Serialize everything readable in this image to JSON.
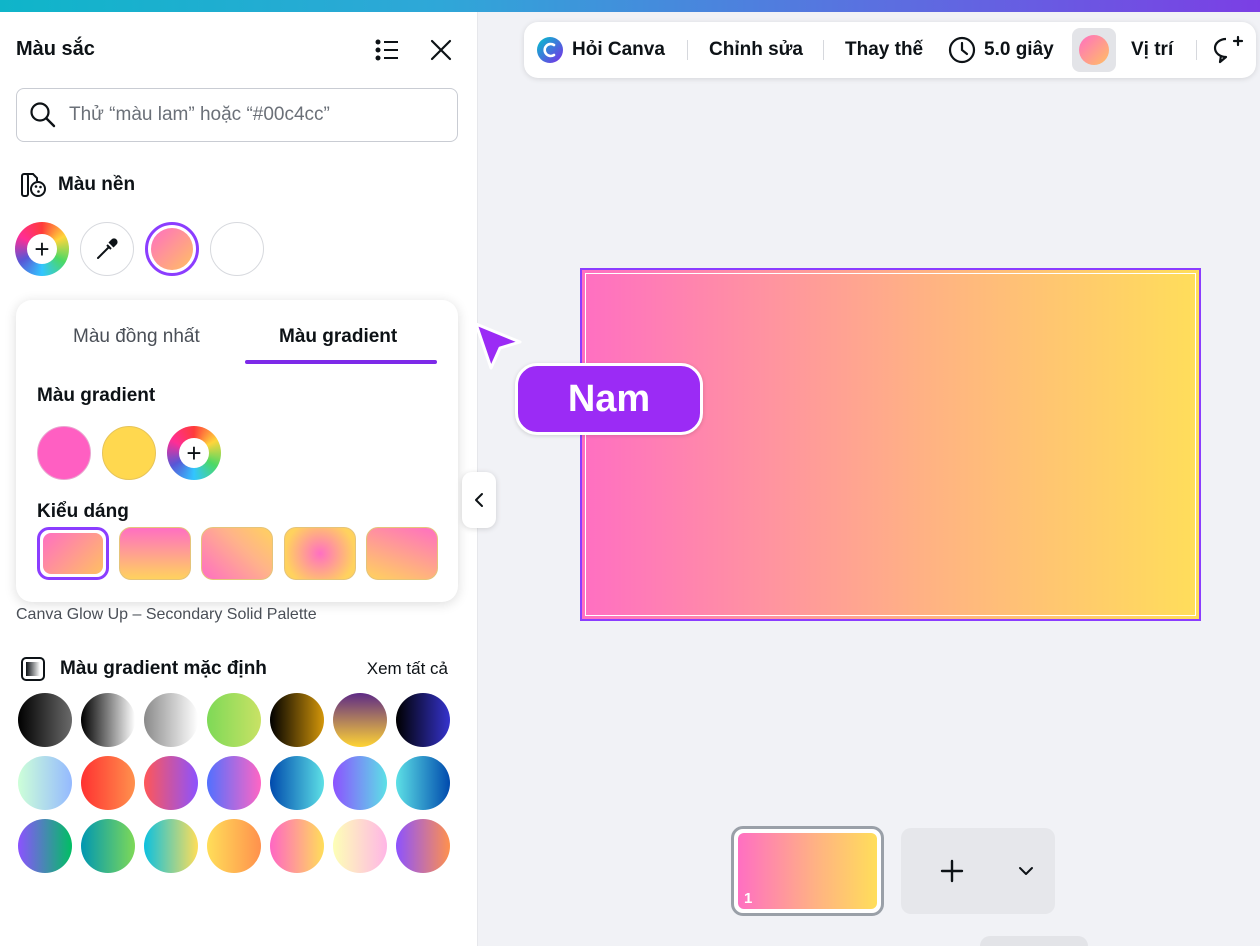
{
  "panel": {
    "title": "Màu sắc",
    "search_placeholder": "Thử “màu lam” hoặc “#00c4cc”",
    "background_section": "Màu nền",
    "tabs": [
      "Màu đồng nhất",
      "Màu gradient"
    ],
    "active_tab": "Màu gradient",
    "gradient_colors_label": "Màu gradient",
    "gradient_colors": [
      "#ff5fc2",
      "#ffd84f"
    ],
    "style_label": "Kiểu dáng",
    "palette_caption": "Canva Glow Up – Secondary Solid Palette",
    "default_gradients_label": "Màu gradient mặc định",
    "see_all": "Xem tất cả"
  },
  "toolbar": {
    "ask": "Hỏi Canva",
    "edit": "Chỉnh sửa",
    "replace": "Thay thế",
    "duration": "5.0 giây",
    "position": "Vị trí"
  },
  "canvas": {
    "collaborator_name": "Nam",
    "page_number": "1",
    "gradient_start": "#ff6fc2",
    "gradient_end": "#ffde5a"
  },
  "colors": {
    "accent": "#7d2ae8",
    "collaborator": "#9b2bf5"
  }
}
